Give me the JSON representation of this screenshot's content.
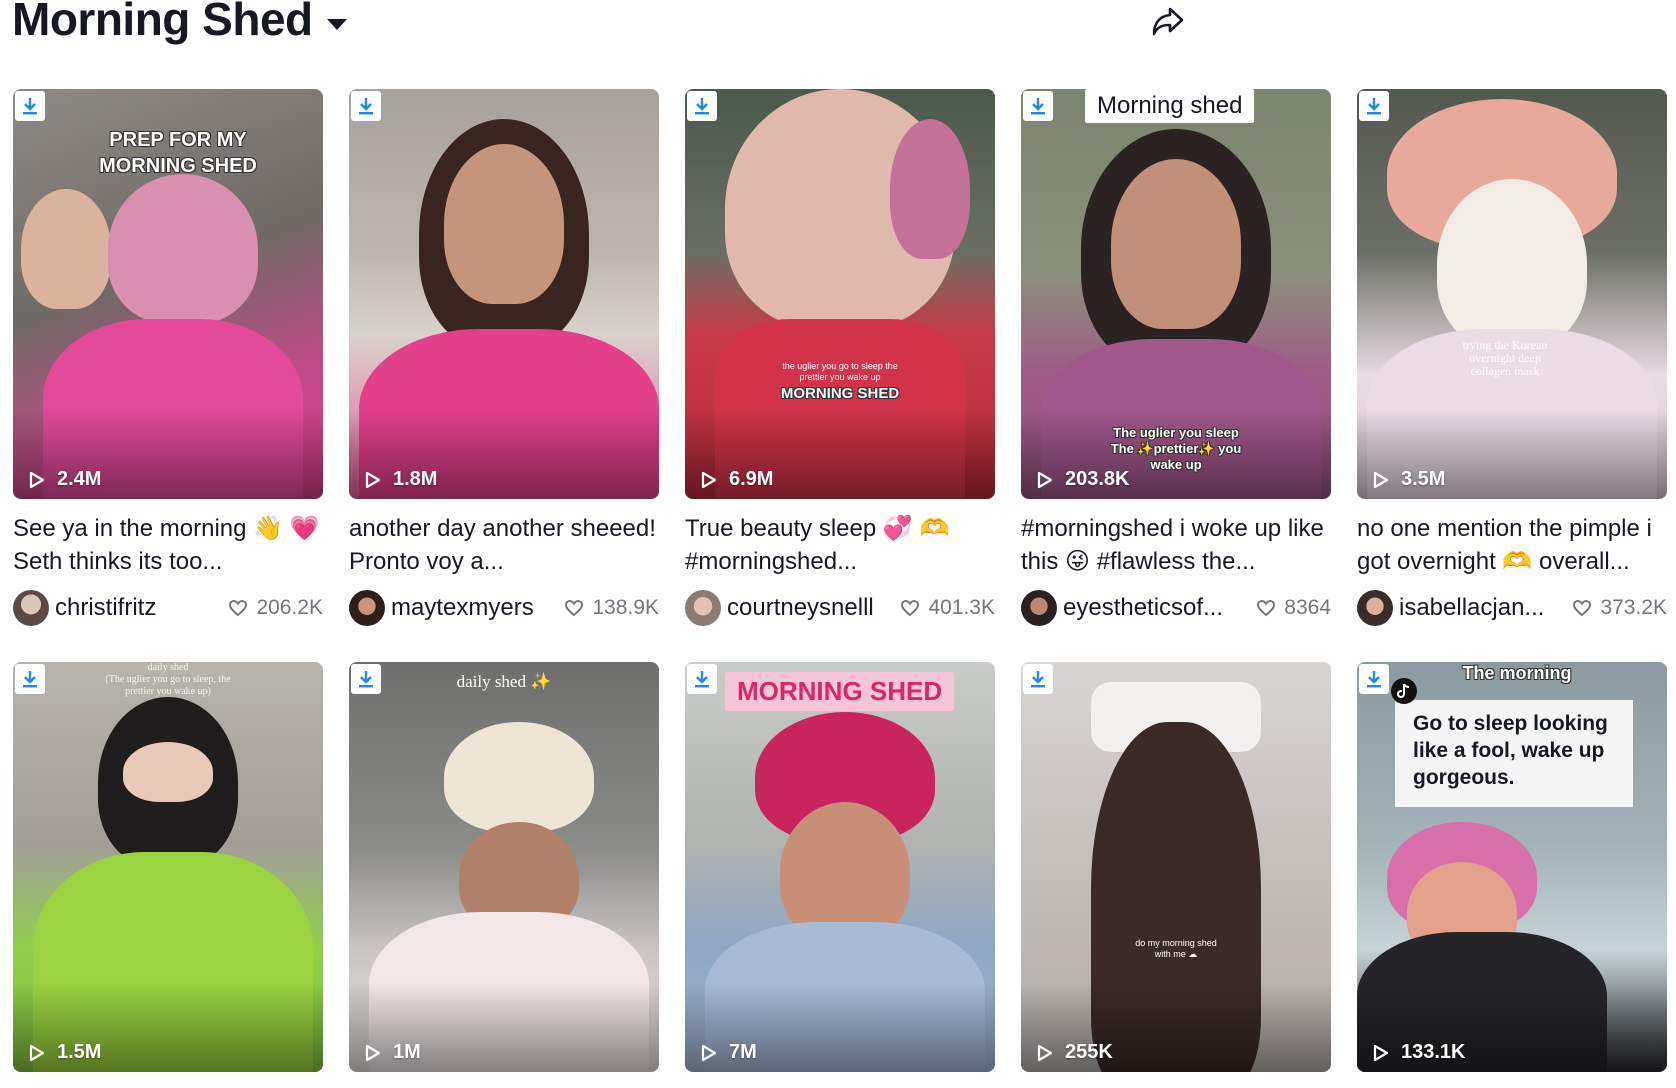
{
  "header": {
    "title": "Morning Shed"
  },
  "colors": {
    "accent": "#fe2c55",
    "text": "#161823",
    "muted": "rgba(22,24,35,0.6)"
  },
  "videos": [
    {
      "views": "2.4M",
      "overlay": [
        "PREP FOR MY",
        "MORNING SHED"
      ],
      "caption": "See ya in the morning 👋 💗 Seth thinks its too...",
      "user": "christifritz",
      "likes": "206.2K"
    },
    {
      "views": "1.8M",
      "overlay": [],
      "caption": "another day another sheeed! Pronto voy a...",
      "user": "maytexmyers",
      "likes": "138.9K"
    },
    {
      "views": "6.9M",
      "overlay": [
        "the uglier you go to sleep the",
        "prettier you wake up",
        "MORNING SHED"
      ],
      "caption": "True beauty sleep 💞 🫶 #morningshed...",
      "user": "courtneysnelll",
      "likes": "401.3K"
    },
    {
      "views": "203.8K",
      "overlay": [
        "Morning shed",
        "The uglier you sleep",
        "The ✨prettier✨ you",
        "wake up"
      ],
      "caption": "#morningshed i woke up like this 😜 #flawless the...",
      "user": "eyestheticsof...",
      "likes": "8364"
    },
    {
      "views": "3.5M",
      "overlay": [
        "trying the Korean",
        "overnight deep",
        "collagen mask"
      ],
      "caption": "no one mention the pimple i got overnight 🫶 overall...",
      "user": "isabellacjan...",
      "likes": "373.2K"
    },
    {
      "views": "1.5M",
      "overlay": [
        "daily shed",
        "(The uglier you go to sleep, the",
        "prettier you wake up)"
      ]
    },
    {
      "views": "1M",
      "overlay": [
        "daily shed ✨"
      ]
    },
    {
      "views": "7M",
      "overlay": [
        "MORNING SHED"
      ]
    },
    {
      "views": "255K",
      "overlay": [
        "do my morning shed",
        "with me ☁"
      ]
    },
    {
      "views": "133.1K",
      "overlay": [
        "The morning",
        "Go to sleep looking",
        "like a fool, wake up",
        "gorgeous."
      ]
    }
  ]
}
